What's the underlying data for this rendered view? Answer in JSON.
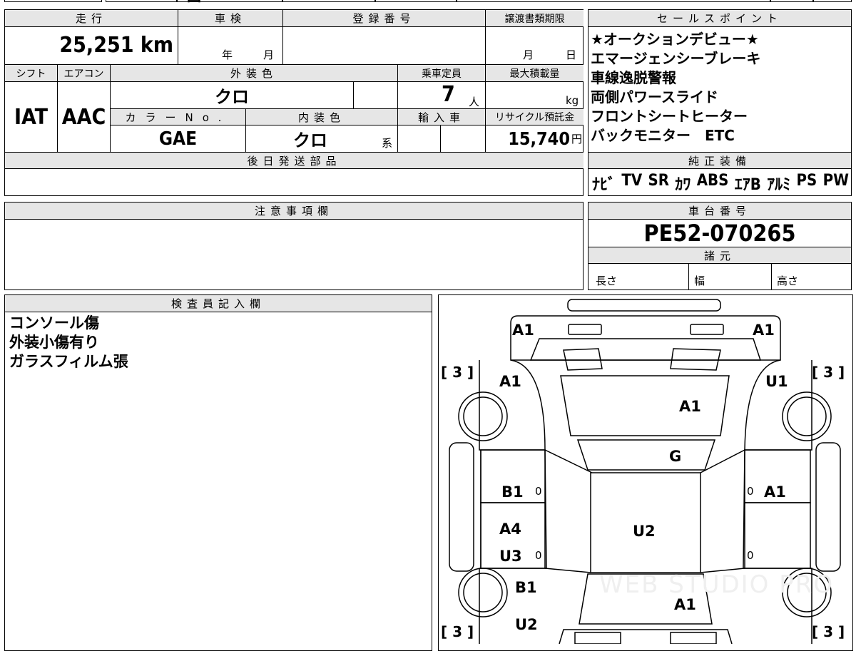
{
  "top_fragment": "国",
  "headers": {
    "mileage": "走行",
    "shaken": "車検",
    "registration_no": "登録番号",
    "transfer_deadline": "譲渡書類期限",
    "sales_points": "セールスポイント",
    "shift": "シフト",
    "aircon": "エアコン",
    "exterior_color": "外装色",
    "capacity": "乗車定員",
    "max_load": "最大積載量",
    "color_no": "カラーNo.",
    "interior_color": "内装色",
    "import": "輸入車",
    "recycle": "リサイクル預託金",
    "later_parts": "後日発送部品",
    "genuine_equipment": "純正装備",
    "notes": "注意事項欄",
    "chassis_no": "車台番号",
    "specs": "諸元",
    "inspector": "検査員記入欄"
  },
  "vehicle": {
    "mileage": "25,251",
    "mileage_unit": "km",
    "year_label": "年",
    "month_label": "月",
    "deadline_month": "月",
    "deadline_day": "日",
    "shift": "IAT",
    "aircon": "AAC",
    "exterior_color": "クロ",
    "capacity": "7",
    "capacity_unit": "人",
    "load_unit": "kg",
    "color_no": "GAE",
    "interior_color": "クロ",
    "interior_suffix": "系",
    "recycle_fee": "15,740",
    "recycle_unit": "円",
    "chassis_no": "PE52-070265"
  },
  "specs": {
    "length": "長さ",
    "width": "幅",
    "height": "高さ"
  },
  "sales_points": [
    "★オークションデビュー★",
    "エマージェンシーブレーキ",
    "車線逸脱警報",
    "両側パワースライド",
    "フロントシートヒーター",
    "バックモニター　ETC"
  ],
  "genuine_equipment": [
    "ﾅﾋﾞ",
    "TV",
    "SR",
    "ｶﾜ",
    "ABS",
    "ｴｱB",
    "ｱﾙﾐ",
    "PS",
    "PW"
  ],
  "inspector_notes": [
    "コンソール傷",
    "外装小傷有り",
    "ガラスフィルム張"
  ],
  "damage_map": {
    "front_left_corner": "A1",
    "front_right_corner": "A1",
    "left_front_fender": "A1",
    "right_front_fender": "U1",
    "hood": "A1",
    "windshield": "G",
    "left_front_door": "B1",
    "right_front_door": "A1",
    "left_rear_door_a": "A4",
    "left_rear_door_b": "U3",
    "roof": "U2",
    "left_rear_fender": "B1",
    "left_rear_lower": "U2",
    "rear_glass": "A1",
    "tire_fl": "3",
    "tire_fr": "3",
    "tire_rl": "3",
    "tire_rr": "3",
    "zero_marks": [
      "0",
      "0",
      "0",
      "0"
    ],
    "watermark": "WEB STUDIO PRO"
  }
}
